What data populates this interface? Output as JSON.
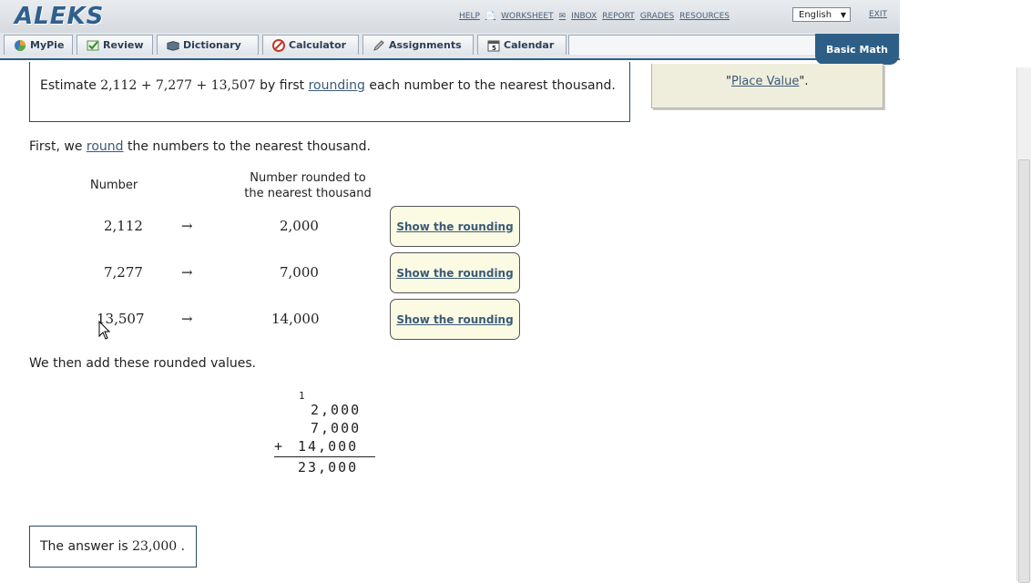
{
  "app": {
    "logo": "ALEKS",
    "top_links": [
      "HELP",
      "WORKSHEET",
      "INBOX",
      "REPORT",
      "GRADES",
      "RESOURCES"
    ],
    "language": "English",
    "exit": "EXIT",
    "course": "Basic Math"
  },
  "tabs": [
    {
      "label": "MyPie",
      "icon": "pie-icon"
    },
    {
      "label": "Review",
      "icon": "check-icon"
    },
    {
      "label": "Dictionary",
      "icon": "book-icon"
    },
    {
      "label": "Calculator",
      "icon": "calculator-icon"
    },
    {
      "label": "Assignments",
      "icon": "pencil-icon"
    },
    {
      "label": "Calendar",
      "icon": "calendar-icon"
    }
  ],
  "problem": {
    "prefix": "Estimate",
    "expression": "2,112 + 7,277 + 13,507",
    "middle": "by first",
    "link": "rounding",
    "suffix": "each number to the nearest thousand."
  },
  "side_panel": {
    "open_quote": "\"",
    "link": "Place Value",
    "close_quote": "\"."
  },
  "explanation": {
    "first_prefix": "First, we",
    "first_link": "round",
    "first_suffix": "the numbers to the nearest thousand.",
    "col_number": "Number",
    "col_rounded_line1": "Number rounded to",
    "col_rounded_line2": "the nearest thousand",
    "arrow": "→",
    "rows": [
      {
        "number": "2,112",
        "rounded": "2,000",
        "button": "Show the rounding"
      },
      {
        "number": "7,277",
        "rounded": "7,000",
        "button": "Show the rounding"
      },
      {
        "number": "13,507",
        "rounded": "14,000",
        "button": "Show the rounding"
      }
    ],
    "then_text": "We then add these rounded values."
  },
  "addition": {
    "carry": "1",
    "line1": "2,000",
    "line2": "7,000",
    "operator": "+",
    "line3": "14,000",
    "result": "23,000"
  },
  "answer": {
    "prefix": "The answer is",
    "value": "23,000",
    "suffix": "."
  }
}
